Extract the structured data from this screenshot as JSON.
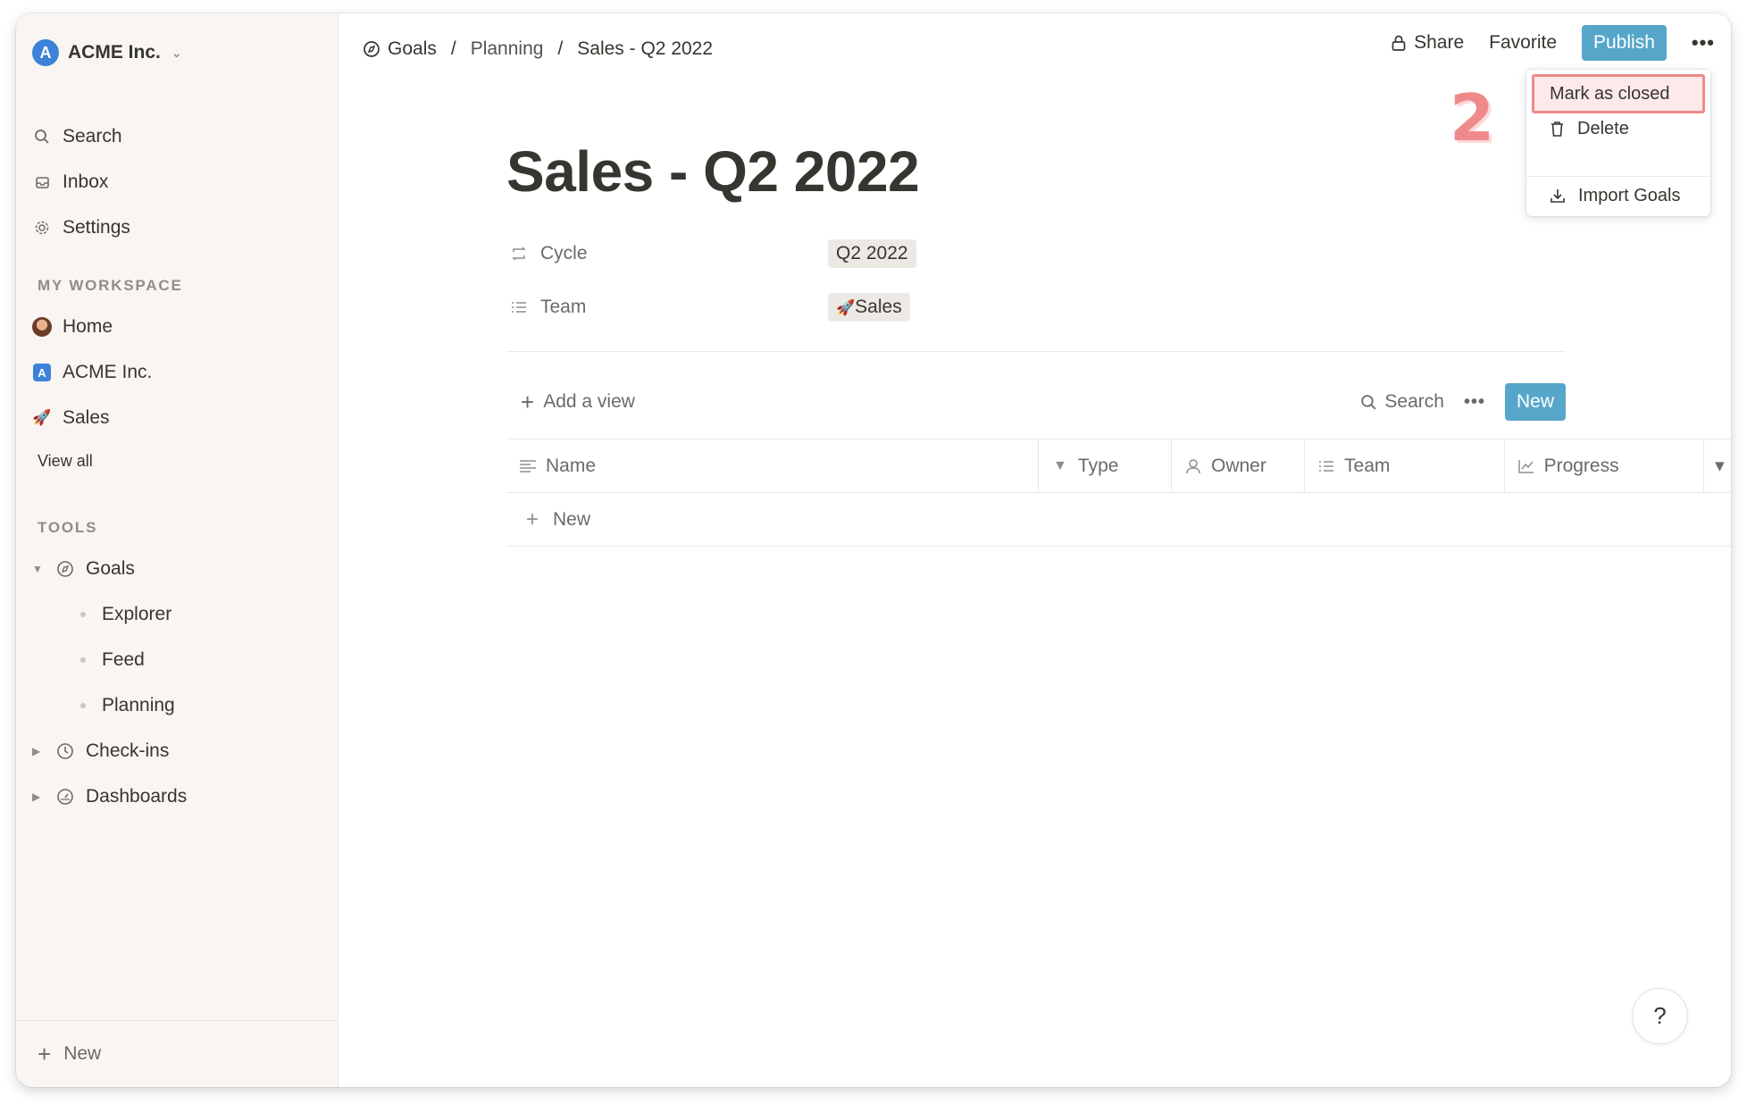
{
  "workspace": {
    "name": "ACME Inc.",
    "logo_letter": "A"
  },
  "sidebar": {
    "top_items": [
      {
        "label": "Search",
        "icon": "search-icon"
      },
      {
        "label": "Inbox",
        "icon": "inbox-icon"
      },
      {
        "label": "Settings",
        "icon": "gear-icon"
      }
    ],
    "workspace_section": {
      "title": "MY WORKSPACE",
      "items": [
        {
          "label": "Home",
          "icon": "avatar"
        },
        {
          "label": "ACME Inc.",
          "icon": "acme-logo-icon"
        },
        {
          "label": "Sales",
          "icon": "rocket-icon"
        }
      ],
      "view_all": "View all"
    },
    "tools_section": {
      "title": "TOOLS",
      "goals": {
        "label": "Goals",
        "children": [
          "Explorer",
          "Feed",
          "Planning"
        ]
      },
      "checkins": "Check-ins",
      "dashboards": "Dashboards"
    },
    "footer_new": "New"
  },
  "breadcrumb": {
    "items": [
      "Goals",
      "Planning",
      "Sales - Q2 2022"
    ],
    "separator": "/"
  },
  "top_actions": {
    "share": "Share",
    "favorite": "Favorite",
    "publish": "Publish",
    "more": "•••"
  },
  "more_menu": {
    "items": [
      "Mark as closed",
      "Delete",
      "Import Goals"
    ],
    "highlighted": "Mark as closed"
  },
  "annotation": {
    "step": "2"
  },
  "page": {
    "title": "Sales - Q2 2022",
    "properties": [
      {
        "key": "Cycle",
        "value": "Q2 2022"
      },
      {
        "key": "Team",
        "value": "Sales",
        "value_icon": "🚀"
      }
    ]
  },
  "database": {
    "add_view": "Add a view",
    "search": "Search",
    "more": "•••",
    "new_button": "New",
    "columns": [
      "Name",
      "Type",
      "Owner",
      "Team",
      "Progress"
    ],
    "new_row": "New"
  },
  "help": "?",
  "colors": {
    "accent": "#56a6c9",
    "sidebar_bg": "#f8f5f2",
    "highlight_border": "#ef8a8a",
    "logo_blue": "#3b82d8"
  }
}
